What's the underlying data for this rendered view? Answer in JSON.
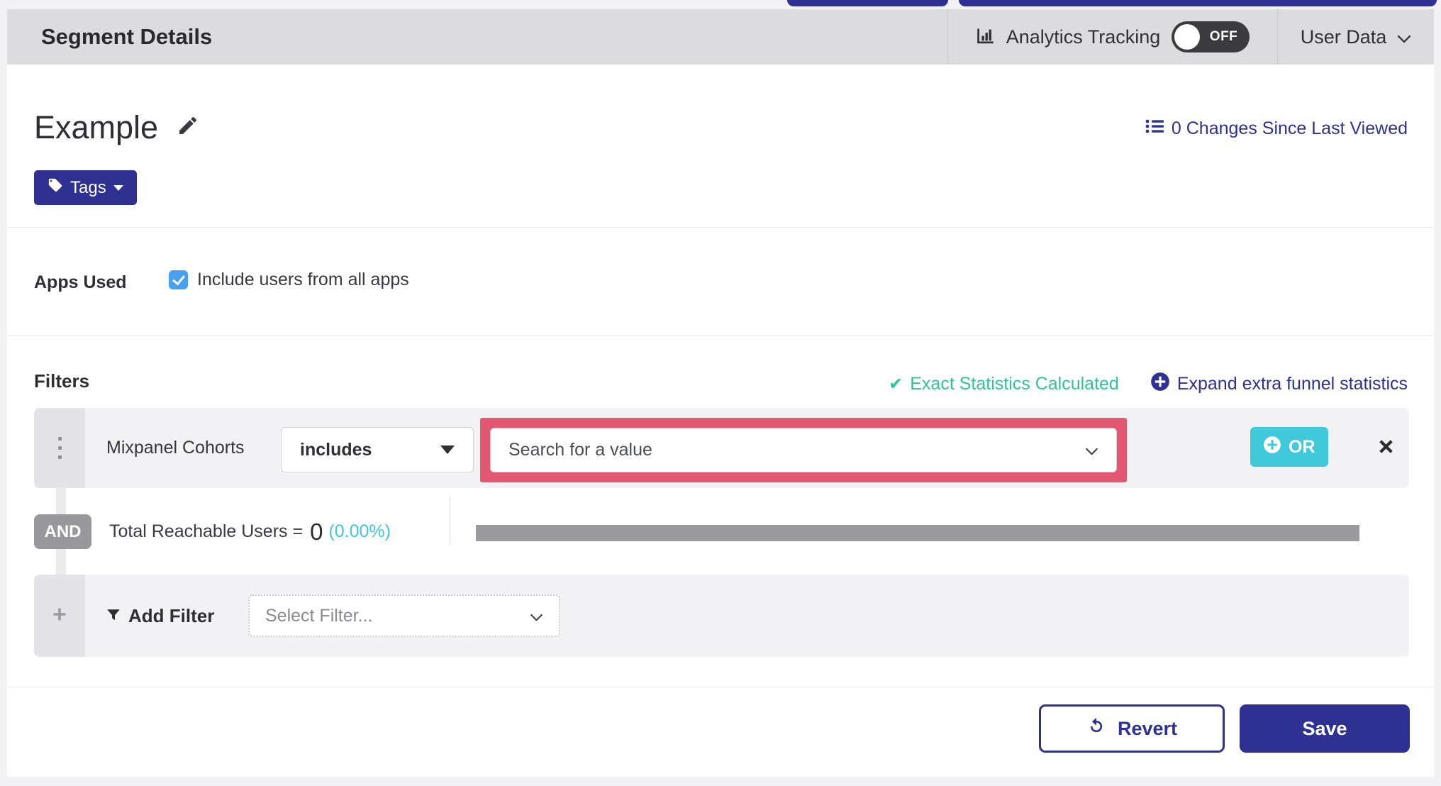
{
  "colors": {
    "indigo": "#2e3192",
    "teal_green": "#2fc39b",
    "cyan": "#3fc9da",
    "pink_highlight": "#e25872",
    "checkbox_blue": "#4aa0f0",
    "toggle_dark": "#3a3a3f"
  },
  "header": {
    "title": "Segment Details",
    "analytics_label": "Analytics Tracking",
    "toggle_state": "OFF",
    "user_data_label": "User Data"
  },
  "segment": {
    "name": "Example",
    "changes_link": "0 Changes Since Last Viewed",
    "tags_label": "Tags"
  },
  "apps_used": {
    "label": "Apps Used",
    "checkbox_label": "Include users from all apps"
  },
  "filters": {
    "heading": "Filters",
    "exact_stats_label": "Exact Statistics Calculated",
    "expand_link_label": "Expand extra funnel statistics",
    "row": {
      "field_label": "Mixpanel Cohorts",
      "operator_value": "includes",
      "value_placeholder": "Search for a value",
      "or_label": "OR"
    },
    "and_badge": "AND",
    "reachable_label": "Total Reachable Users =",
    "reachable_value": "0",
    "reachable_percent": "(0.00%)",
    "add_filter_label": "Add Filter",
    "select_filter_placeholder": "Select Filter..."
  },
  "footer": {
    "revert_label": "Revert",
    "save_label": "Save"
  }
}
